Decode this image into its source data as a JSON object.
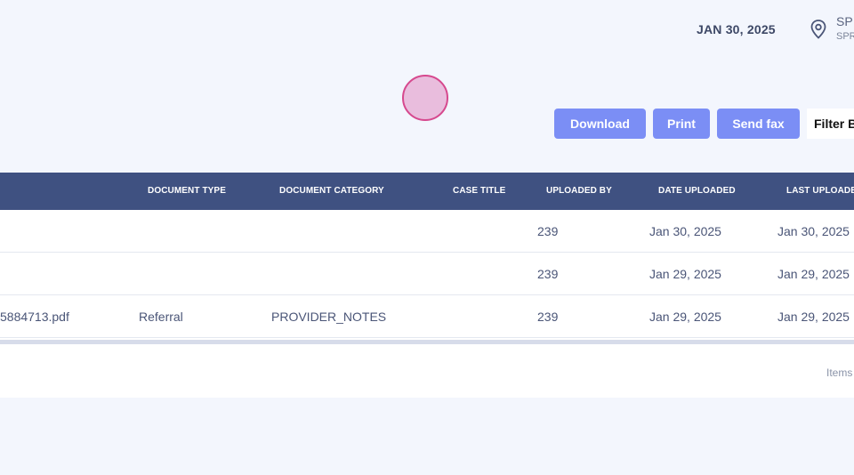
{
  "header": {
    "date": "JAN 30, 2025",
    "location_icon": "map-pin-icon",
    "location_title": "SP",
    "location_subtitle": "SPR"
  },
  "toolbar": {
    "download_label": "Download",
    "print_label": "Print",
    "fax_label": "Send fax",
    "filter_label": "Filter B"
  },
  "table": {
    "columns": [
      "DOCUMENT TYPE",
      "DOCUMENT CATEGORY",
      "CASE TITLE",
      "UPLOADED BY",
      "DATE UPLOADED",
      "LAST UPLOADE"
    ],
    "rows": [
      {
        "file": "",
        "doc_type": "",
        "doc_category": "",
        "case_title": "",
        "uploaded_by": "239",
        "date_uploaded": "Jan 30, 2025",
        "last_uploaded": "Jan 30, 2025"
      },
      {
        "file": "",
        "doc_type": "",
        "doc_category": "",
        "case_title": "",
        "uploaded_by": "239",
        "date_uploaded": "Jan 29, 2025",
        "last_uploaded": "Jan 29, 2025"
      },
      {
        "file": "5884713.pdf",
        "doc_type": "Referral",
        "doc_category": "PROVIDER_NOTES",
        "case_title": "",
        "uploaded_by": "239",
        "date_uploaded": "Jan 29, 2025",
        "last_uploaded": "Jan 29, 2025"
      }
    ],
    "footer_text": "Items"
  },
  "colors": {
    "background": "#f3f6fd",
    "table_header": "#3f5181",
    "button": "#7b8ef5",
    "cursor_marker": "#d6498e"
  }
}
